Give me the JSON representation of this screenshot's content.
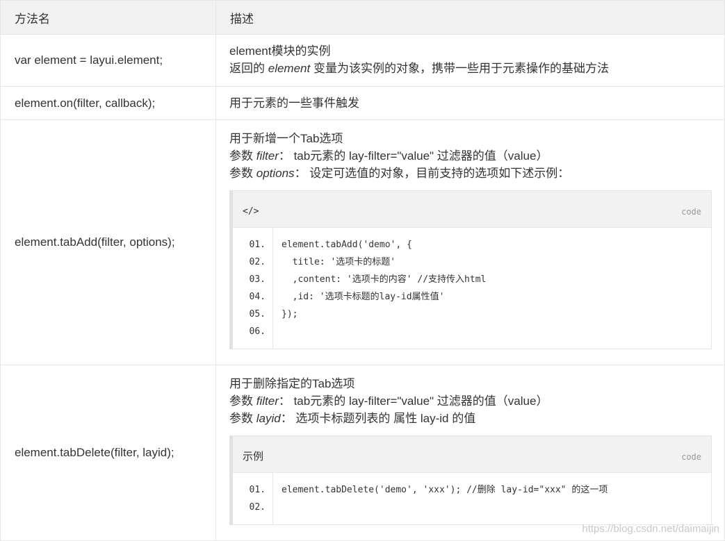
{
  "header": {
    "col1": "方法名",
    "col2": "描述"
  },
  "rows": [
    {
      "method": "var element = layui.element;",
      "lines": [
        "element模块的实例"
      ],
      "line2": {
        "pre": "返回的 ",
        "em": "element",
        "post": " 变量为该实例的对象，携带一些用于元素操作的基础方法"
      }
    },
    {
      "method": "element.on(filter, callback);",
      "lines": [
        "用于元素的一些事件触发"
      ]
    },
    {
      "method": "element.tabAdd(filter, options);",
      "line1": "用于新增一个Tab选项",
      "p1": {
        "pre": "参数 ",
        "em": "filter",
        "post": "： tab元素的 lay-filter=\"value\" 过滤器的值（value）"
      },
      "p2": {
        "pre": "参数 ",
        "em": "options",
        "post": "： 设定可选值的对象，目前支持的选项如下述示例："
      },
      "code": {
        "title": "</>",
        "lang": "code",
        "nums": [
          "01.",
          "02.",
          "03.",
          "04.",
          "05.",
          "06."
        ],
        "lines": [
          "element.tabAdd('demo', {",
          "  title: '选项卡的标题'",
          "  ,content: '选项卡的内容' //支持传入html",
          "  ,id: '选项卡标题的lay-id属性值'",
          "});",
          ""
        ]
      }
    },
    {
      "method": "element.tabDelete(filter, layid);",
      "line1": "用于删除指定的Tab选项",
      "p1": {
        "pre": "参数 ",
        "em": "filter",
        "post": "： tab元素的 lay-filter=\"value\" 过滤器的值（value）"
      },
      "p2": {
        "pre": "参数 ",
        "em": "layid",
        "post": "： 选项卡标题列表的 属性 lay-id 的值"
      },
      "code": {
        "title": "示例",
        "lang": "code",
        "nums": [
          "01.",
          "02."
        ],
        "lines": [
          "element.tabDelete('demo', 'xxx'); //删除 lay-id=\"xxx\" 的这一项",
          ""
        ]
      }
    }
  ],
  "watermark": "https://blog.csdn.net/daimaijin"
}
